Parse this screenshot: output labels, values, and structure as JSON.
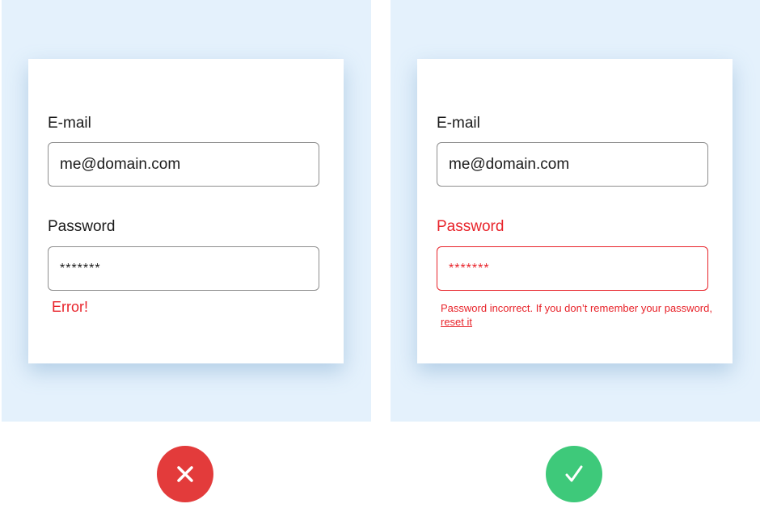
{
  "bad_example": {
    "email_label": "E-mail",
    "email_value": "me@domain.com",
    "password_label": "Password",
    "password_value": "*******",
    "error_text": "Error!"
  },
  "good_example": {
    "email_label": "E-mail",
    "email_value": "me@domain.com",
    "password_label": "Password",
    "password_value": "*******",
    "error_text": "Password incorrect. If you don’t remember your password, ",
    "reset_link": "reset it"
  },
  "icons": {
    "bad": "x-icon",
    "good": "checkmark-icon"
  },
  "colors": {
    "panel_bg": "#e4f1fc",
    "error_red": "#e8232a",
    "bad_badge": "#e33b3b",
    "good_badge": "#3ec97a"
  }
}
